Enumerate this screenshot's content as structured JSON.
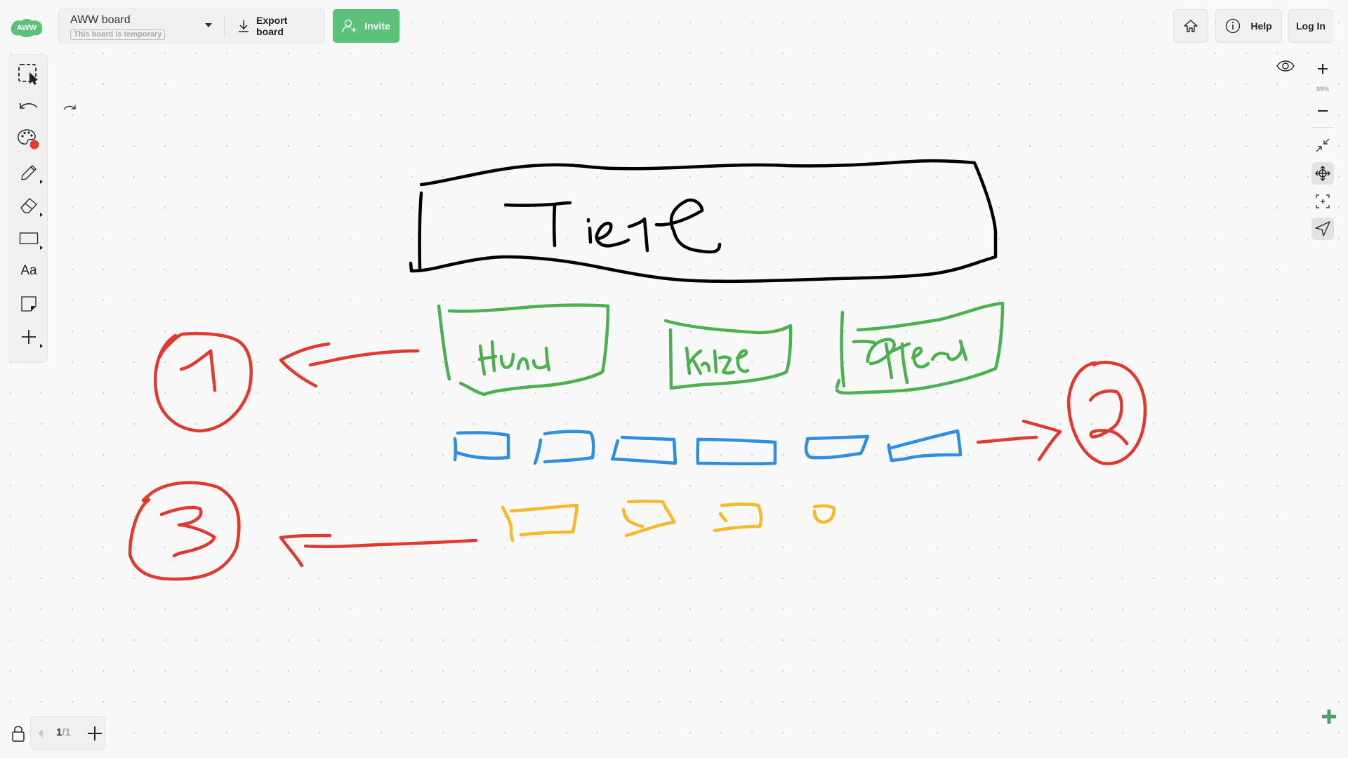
{
  "header": {
    "logo_text": "AWW",
    "board_name": "AWW board",
    "board_status": "This board is temporary",
    "export_label": "Export board",
    "invite_label": "Invite",
    "help_label": "Help",
    "login_label": "Log In"
  },
  "toolbar": {
    "tools": [
      {
        "name": "select",
        "icon": "select-icon"
      },
      {
        "name": "undo",
        "icon": "undo-icon"
      },
      {
        "name": "color",
        "icon": "palette-icon",
        "current_color": "#e53935"
      },
      {
        "name": "pen",
        "icon": "pencil-icon"
      },
      {
        "name": "eraser",
        "icon": "eraser-icon"
      },
      {
        "name": "shape",
        "icon": "rectangle-icon"
      },
      {
        "name": "text",
        "icon": "text-icon",
        "label": "Aa"
      },
      {
        "name": "sticky-note",
        "icon": "sticky-note-icon"
      },
      {
        "name": "more",
        "icon": "plus-icon"
      }
    ],
    "redo_icon": "redo-icon"
  },
  "view_controls": {
    "zoom_level": "89%",
    "items": [
      "zoom-in",
      "zoom-out",
      "fit-to-screen",
      "pan",
      "center",
      "pointer"
    ],
    "active": [
      "pan",
      "pointer"
    ]
  },
  "pager": {
    "current": "1",
    "total": "/1"
  },
  "colors": {
    "brand": "#5cc17b",
    "black_ink": "#000000",
    "green_ink": "#4caf50",
    "blue_ink": "#2f8ee0",
    "yellow_ink": "#f6b92b",
    "red_ink": "#e03a2e"
  },
  "drawing": {
    "title": "Tiere",
    "categories": [
      "Hund",
      "Katze",
      "Pferd"
    ],
    "markers": [
      "1",
      "2",
      "3"
    ]
  }
}
